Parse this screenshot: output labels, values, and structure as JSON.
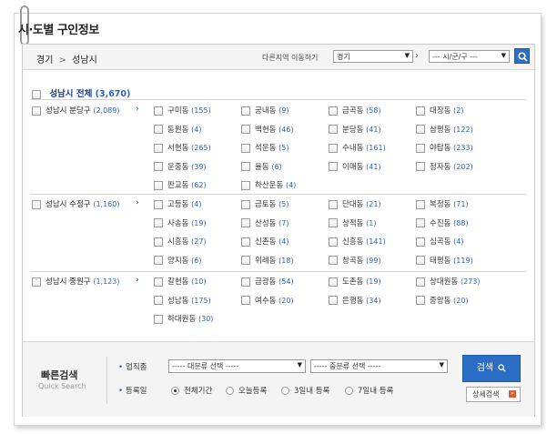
{
  "title": "시·도별 구인정보",
  "breadcrumb": {
    "region": "경기",
    "separator": ">",
    "city": "성남시"
  },
  "region_move": {
    "label": "다른지역 이동하기",
    "province_select": "경기",
    "city_select": "--- 시/군/구 ---"
  },
  "all": {
    "label": "성남시 전체",
    "count": "(3,670)"
  },
  "districts": [
    {
      "name": "성남시 분당구",
      "count": "(2,089)",
      "dongs": [
        {
          "name": "구미동",
          "count": "(155)"
        },
        {
          "name": "궁내동",
          "count": "(9)"
        },
        {
          "name": "금곡동",
          "count": "(58)"
        },
        {
          "name": "대장동",
          "count": "(2)"
        },
        {
          "name": "동원동",
          "count": "(4)"
        },
        {
          "name": "백현동",
          "count": "(46)"
        },
        {
          "name": "분당동",
          "count": "(41)"
        },
        {
          "name": "삼평동",
          "count": "(122)"
        },
        {
          "name": "서현동",
          "count": "(265)"
        },
        {
          "name": "석운동",
          "count": "(5)"
        },
        {
          "name": "수내동",
          "count": "(161)"
        },
        {
          "name": "야탑동",
          "count": "(233)"
        },
        {
          "name": "운중동",
          "count": "(39)"
        },
        {
          "name": "율동",
          "count": "(6)"
        },
        {
          "name": "이매동",
          "count": "(41)"
        },
        {
          "name": "정자동",
          "count": "(202)"
        },
        {
          "name": "판교동",
          "count": "(62)"
        },
        {
          "name": "하산운동",
          "count": "(4)"
        }
      ]
    },
    {
      "name": "성남시 수정구",
      "count": "(1,160)",
      "dongs": [
        {
          "name": "고등동",
          "count": "(4)"
        },
        {
          "name": "금토동",
          "count": "(5)"
        },
        {
          "name": "단대동",
          "count": "(21)"
        },
        {
          "name": "복정동",
          "count": "(71)"
        },
        {
          "name": "사송동",
          "count": "(19)"
        },
        {
          "name": "산성동",
          "count": "(7)"
        },
        {
          "name": "상적동",
          "count": "(1)"
        },
        {
          "name": "수진동",
          "count": "(88)"
        },
        {
          "name": "시흥동",
          "count": "(27)"
        },
        {
          "name": "신촌동",
          "count": "(4)"
        },
        {
          "name": "신흥동",
          "count": "(141)"
        },
        {
          "name": "심곡동",
          "count": "(4)"
        },
        {
          "name": "양지동",
          "count": "(6)"
        },
        {
          "name": "위례동",
          "count": "(18)"
        },
        {
          "name": "창곡동",
          "count": "(99)"
        },
        {
          "name": "태평동",
          "count": "(119)"
        }
      ]
    },
    {
      "name": "성남시 중원구",
      "count": "(1,123)",
      "dongs": [
        {
          "name": "갈현동",
          "count": "(10)"
        },
        {
          "name": "금광동",
          "count": "(54)"
        },
        {
          "name": "도촌동",
          "count": "(19)"
        },
        {
          "name": "상대원동",
          "count": "(273)"
        },
        {
          "name": "성남동",
          "count": "(175)"
        },
        {
          "name": "여수동",
          "count": "(20)"
        },
        {
          "name": "은행동",
          "count": "(34)"
        },
        {
          "name": "중앙동",
          "count": "(20)"
        },
        {
          "name": "하대원동",
          "count": "(30)"
        }
      ]
    }
  ],
  "quick_search": {
    "title": "빠른검색",
    "subtitle": "Quick Search",
    "industry_label": "업직종",
    "major_select": "----- 대분류 선택 -----",
    "minor_select": "----- 중분류 선택 -----",
    "regdate_label": "등록일",
    "options": [
      "전체기간",
      "오늘등록",
      "3일내 등록",
      "7일내 등록"
    ],
    "search_button": "검색",
    "detail_button": "상세검색"
  }
}
